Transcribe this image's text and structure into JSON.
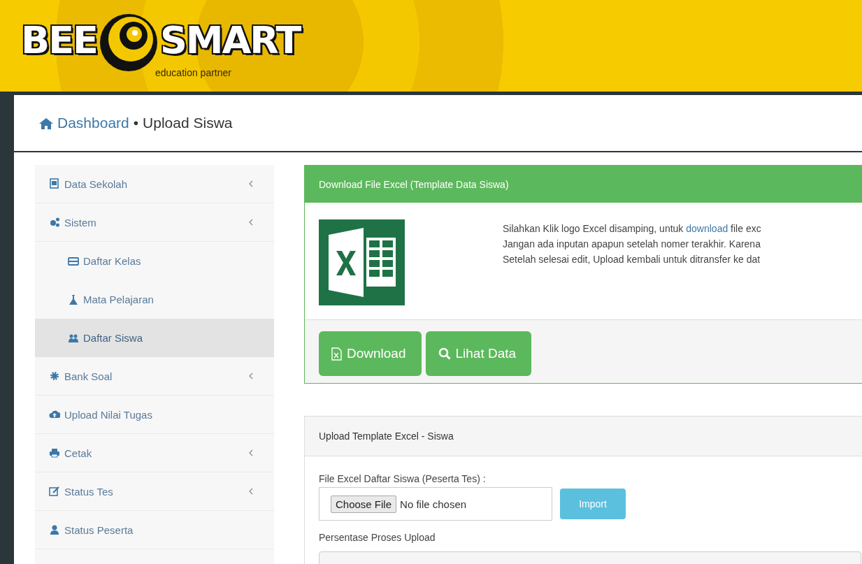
{
  "header": {
    "brand_left": "BEE",
    "brand_right": "SMART",
    "tagline": "education partner"
  },
  "breadcrumb": {
    "home": "Dashboard",
    "separator": "•",
    "current": "Upload Siswa"
  },
  "sidebar": {
    "items": [
      {
        "label": "Data Sekolah",
        "has_submenu": true,
        "selected": false
      },
      {
        "label": "Sistem",
        "has_submenu": true,
        "selected": false,
        "children": [
          {
            "label": "Daftar Kelas",
            "selected": false
          },
          {
            "label": "Mata Pelajaran",
            "selected": false
          },
          {
            "label": "Daftar Siswa",
            "selected": true
          }
        ]
      },
      {
        "label": "Bank Soal",
        "has_submenu": true,
        "selected": false
      },
      {
        "label": "Upload Nilai Tugas",
        "has_submenu": false,
        "selected": false
      },
      {
        "label": "Cetak",
        "has_submenu": true,
        "selected": false
      },
      {
        "label": "Status Tes",
        "has_submenu": true,
        "selected": false
      },
      {
        "label": "Status Peserta",
        "has_submenu": false,
        "selected": false
      }
    ]
  },
  "download_panel": {
    "title": "Download File Excel (Template Data Siswa)",
    "lines": [
      {
        "before": "Silahkan Klik logo Excel disamping, untuk ",
        "link": "download",
        "after": " file exc"
      },
      {
        "before": "Jangan ada inputan apapun setelah nomer terakhir. Karena"
      },
      {
        "before": "Setelah selesai edit, Upload kembali untuk ditransfer ke dat"
      }
    ],
    "buttons": [
      "Download",
      "Lihat Data"
    ]
  },
  "upload_panel": {
    "title": "Upload Template Excel - Siswa",
    "file_label": "File Excel Daftar Siswa (Peserta Tes) :",
    "choose_button": "Choose File",
    "file_status": "No file chosen",
    "import_button": "Import",
    "progress_label": "Persentase Proses Upload",
    "progress": {
      "level": 0
    }
  }
}
